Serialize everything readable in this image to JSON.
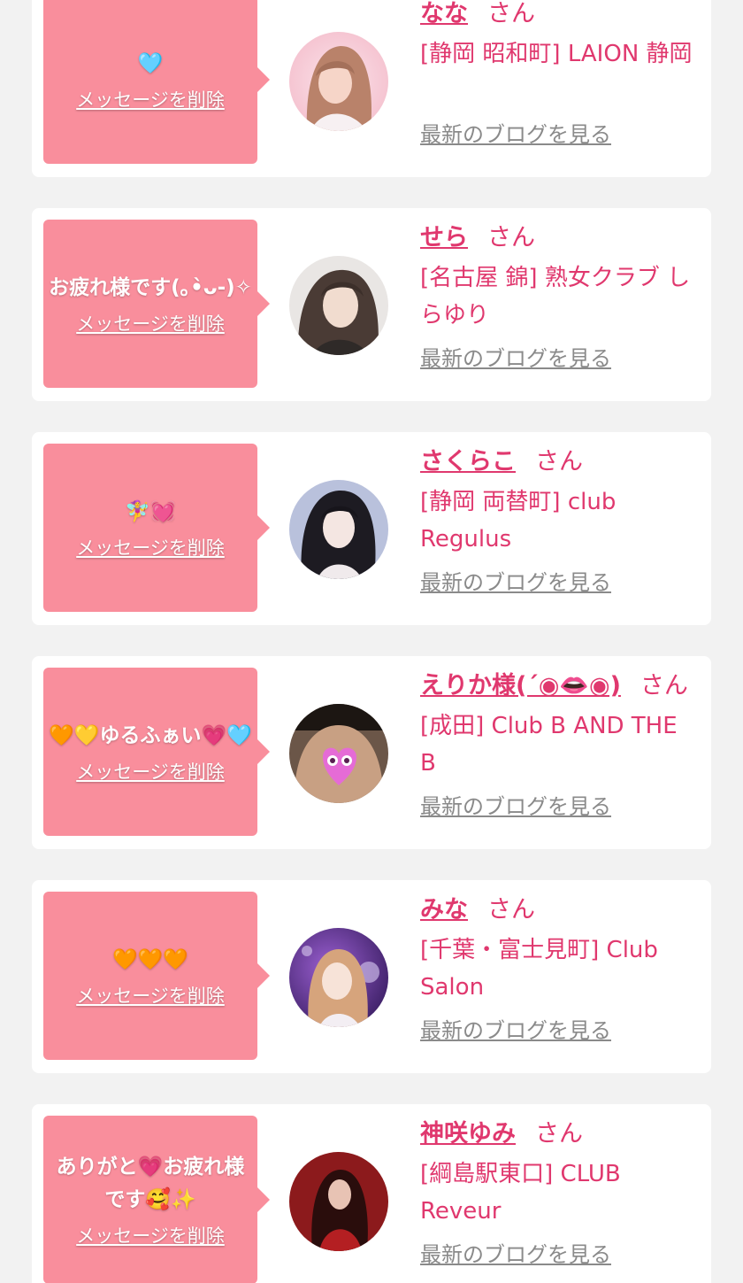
{
  "delete_label": "メッセージを削除",
  "honorific": "さん",
  "blog_label": "最新のブログを見る",
  "colors": {
    "background": "#f2f2f2",
    "card": "#ffffff",
    "bubble": "#f98e9c",
    "accent": "#e0386e",
    "link_gray": "#8a8a8a"
  },
  "cards": [
    {
      "message": "🩵",
      "name": "なな",
      "shop": "[静岡 昭和町] LAION 静岡",
      "avatar": "avatar-photo-nana"
    },
    {
      "message": "お疲れ様です(｡•̀ᴗ-)✧",
      "name": "せら",
      "shop": "[名古屋 錦] 熟女クラブ しらゆり",
      "avatar": "avatar-photo-sera"
    },
    {
      "message": "🧚‍♀️💓",
      "name": "さくらこ",
      "shop": "[静岡 両替町] club Regulus",
      "avatar": "avatar-photo-sakurako"
    },
    {
      "message": "🧡💛ゆるふぁい💗🩵",
      "name": "えりか様(´◉👄◉)",
      "shop": "[成田] Club B AND THE B",
      "avatar": "avatar-photo-erika"
    },
    {
      "message": "🧡🧡🧡",
      "name": "みな",
      "shop": "[千葉・富士見町] Club Salon",
      "avatar": "avatar-photo-mina"
    },
    {
      "message": "ありがと💗お疲れ様です🥰✨",
      "name": "神咲ゆみ",
      "shop": "[綱島駅東口] CLUB Reveur",
      "avatar": "avatar-photo-yumi"
    }
  ]
}
